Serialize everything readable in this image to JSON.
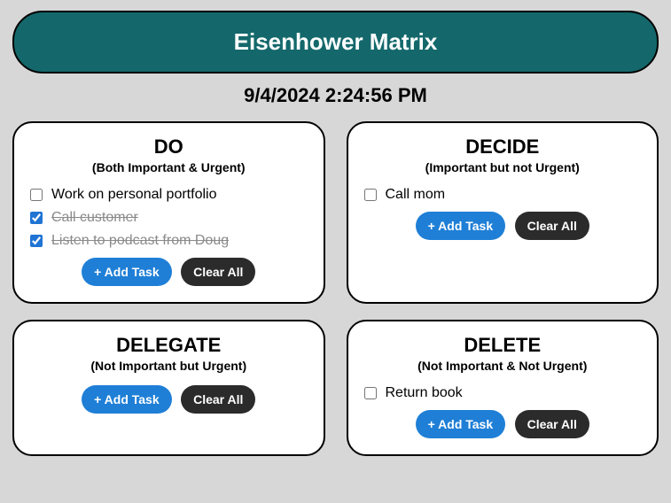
{
  "header": {
    "title": "Eisenhower Matrix"
  },
  "timestamp": "9/4/2024 2:24:56 PM",
  "buttons": {
    "add": "+ Add Task",
    "clear": "Clear All"
  },
  "quadrants": {
    "do": {
      "title": "DO",
      "subtitle": "(Both Important & Urgent)",
      "tasks": [
        {
          "label": "Work on personal portfolio",
          "done": false
        },
        {
          "label": "Call customer",
          "done": true
        },
        {
          "label": "Listen to podcast from Doug",
          "done": true
        }
      ]
    },
    "decide": {
      "title": "DECIDE",
      "subtitle": "(Important but not Urgent)",
      "tasks": [
        {
          "label": "Call mom",
          "done": false
        }
      ]
    },
    "delegate": {
      "title": "DELEGATE",
      "subtitle": "(Not Important but Urgent)",
      "tasks": []
    },
    "delete": {
      "title": "DELETE",
      "subtitle": "(Not Important & Not Urgent)",
      "tasks": [
        {
          "label": "Return book",
          "done": false
        }
      ]
    }
  }
}
